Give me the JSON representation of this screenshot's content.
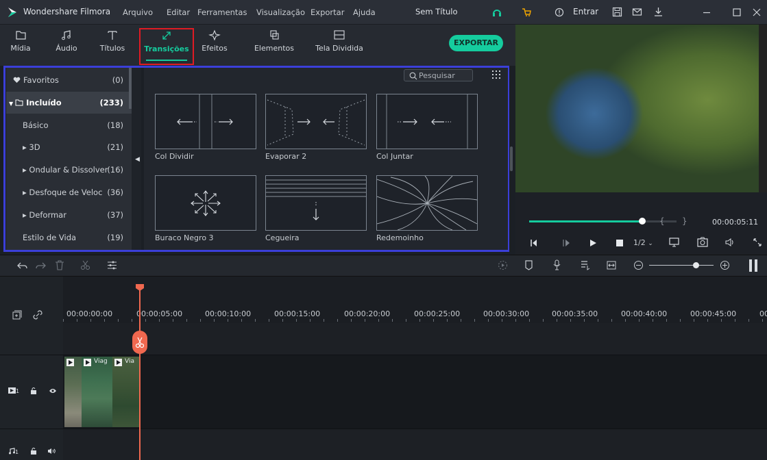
{
  "app": {
    "logo_icon": "filmora-logo-icon",
    "title": "Wondershare Filmora",
    "project": "Sem Título",
    "signin": "Entrar"
  },
  "menu": [
    "Arquivo",
    "Editar",
    "Ferramentas",
    "Visualização",
    "Exportar",
    "Ajuda"
  ],
  "toolbar": {
    "tabs": [
      {
        "label": "Mídia",
        "icon": "folder-icon"
      },
      {
        "label": "Áudio",
        "icon": "music-note-icon"
      },
      {
        "label": "Títulos",
        "icon": "text-icon"
      },
      {
        "label": "Transições",
        "icon": "transition-icon",
        "active": true
      },
      {
        "label": "Efeitos",
        "icon": "sparkle-icon"
      },
      {
        "label": "Elementos",
        "icon": "elements-icon"
      },
      {
        "label": "Tela Dividida",
        "icon": "split-screen-icon"
      }
    ],
    "export_label": "EXPORTAR"
  },
  "sidebar": {
    "items": [
      {
        "label": "Favoritos",
        "count": "(0)"
      },
      {
        "label": "Incluído",
        "count": "(233)"
      },
      {
        "label": "Básico",
        "count": "(18)"
      },
      {
        "label": "▸ 3D",
        "count": "(21)"
      },
      {
        "label": "▸ Ondular & Dissolver",
        "count": "(16)"
      },
      {
        "label": "▸ Desfoque de Veloc",
        "count": "(36)"
      },
      {
        "label": "▸ Deformar",
        "count": "(37)"
      },
      {
        "label": "Estilo de Vida",
        "count": "(19)"
      }
    ]
  },
  "library": {
    "search_placeholder": "Pesquisar",
    "cards": [
      {
        "label": "Col Dividir"
      },
      {
        "label": "Evaporar 2"
      },
      {
        "label": "Col Juntar"
      },
      {
        "label": "Buraco Negro 3"
      },
      {
        "label": "Cegueira"
      },
      {
        "label": "Redemoinho"
      }
    ]
  },
  "preview": {
    "timecode": "00:00:05:11",
    "progress": 0.78,
    "ratio": "1/2",
    "bracket_in": "{",
    "bracket_out": "}"
  },
  "timeline": {
    "ruler": [
      "00:00:00:00",
      "00:00:05:00",
      "00:00:10:00",
      "00:00:15:00",
      "00:00:20:00",
      "00:00:25:00",
      "00:00:30:00",
      "00:00:35:00",
      "00:00:40:00",
      "00:00:45:00",
      "00:"
    ],
    "clip_labels": [
      "Viag",
      "Via"
    ],
    "video_track": "1",
    "audio_track": "1"
  },
  "colors": {
    "accent": "#15cc9e",
    "highlight_red": "#e01b24",
    "highlight_blue": "#3b3fd9",
    "playhead": "#f0684f"
  }
}
